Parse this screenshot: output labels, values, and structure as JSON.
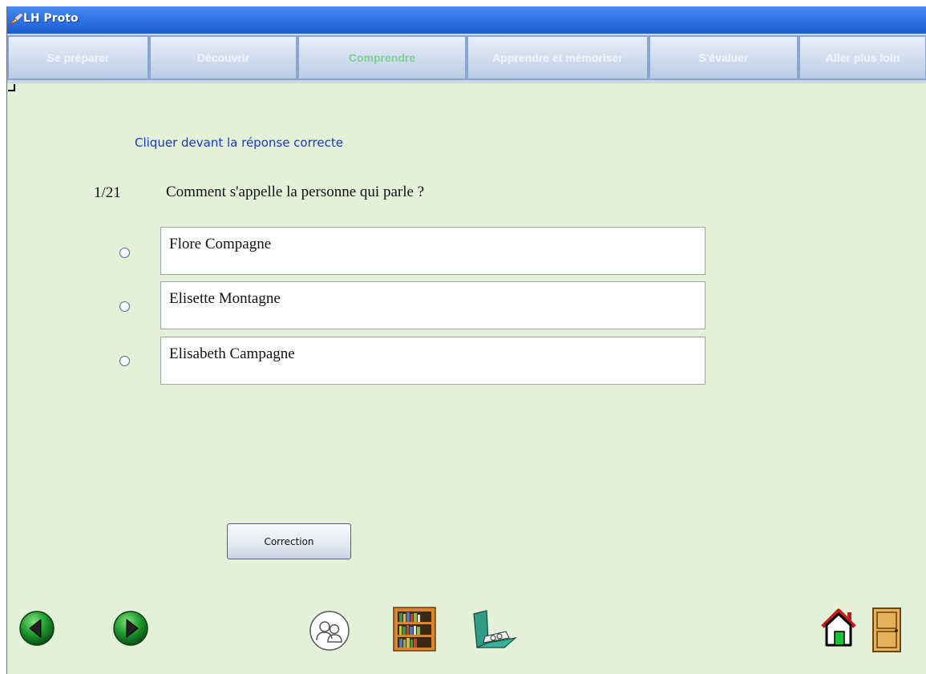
{
  "window": {
    "title": "LH Proto"
  },
  "tabs": [
    {
      "label": "Se préparer",
      "active": false
    },
    {
      "label": "Découvrir",
      "active": false
    },
    {
      "label": "Comprendre",
      "active": true
    },
    {
      "label": "Apprendre et mémoriser",
      "active": false
    },
    {
      "label": "S'évaluer",
      "active": false
    },
    {
      "label": "Aller plus loin",
      "active": false
    }
  ],
  "quiz": {
    "instruction": "Cliquer devant la réponse correcte",
    "question_number": "1/21",
    "question": "Comment s'appelle la personne qui parle ?",
    "answers": [
      {
        "text": "Flore Compagne",
        "selected": false
      },
      {
        "text": "Elisette Montagne",
        "selected": false
      },
      {
        "text": "Elisabeth Campagne",
        "selected": false
      }
    ],
    "correction_label": "Correction"
  },
  "toolbar": {
    "icons": [
      "previous-arrow-icon",
      "next-arrow-icon",
      "people-icon",
      "bookshelf-icon",
      "folder-icon",
      "home-icon",
      "exit-door-icon"
    ]
  },
  "colors": {
    "background": "#e3f1d8",
    "instruction_text": "#1638c8",
    "active_tab_text": "#7dd08f",
    "titlebar": "#2f74e6"
  }
}
